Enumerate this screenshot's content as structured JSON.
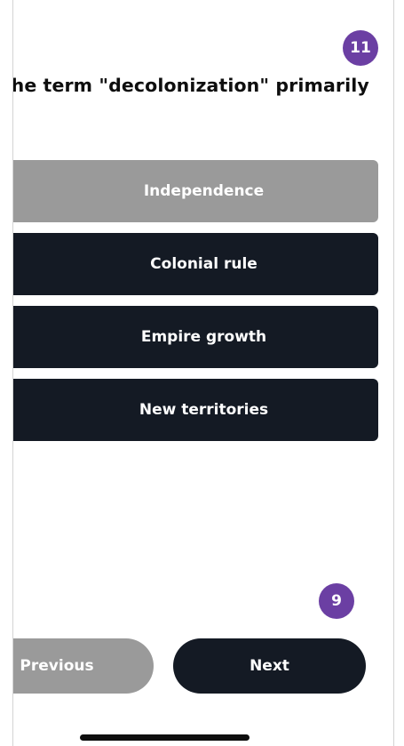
{
  "quiz": {
    "question_number": "11",
    "question_text": "oes the term \"decolonization\" primarily\n?",
    "options": [
      {
        "label": "Independence",
        "selected": true
      },
      {
        "label": "Colonial rule",
        "selected": false
      },
      {
        "label": "Empire growth",
        "selected": false
      },
      {
        "label": "New territories",
        "selected": false
      }
    ]
  },
  "navigation": {
    "page_badge": "9",
    "previous_label": "Previous",
    "next_label": "Next"
  },
  "colors": {
    "accent": "#6b3fa3",
    "dark_button": "#141a24",
    "muted_button": "#9a9a9a"
  }
}
